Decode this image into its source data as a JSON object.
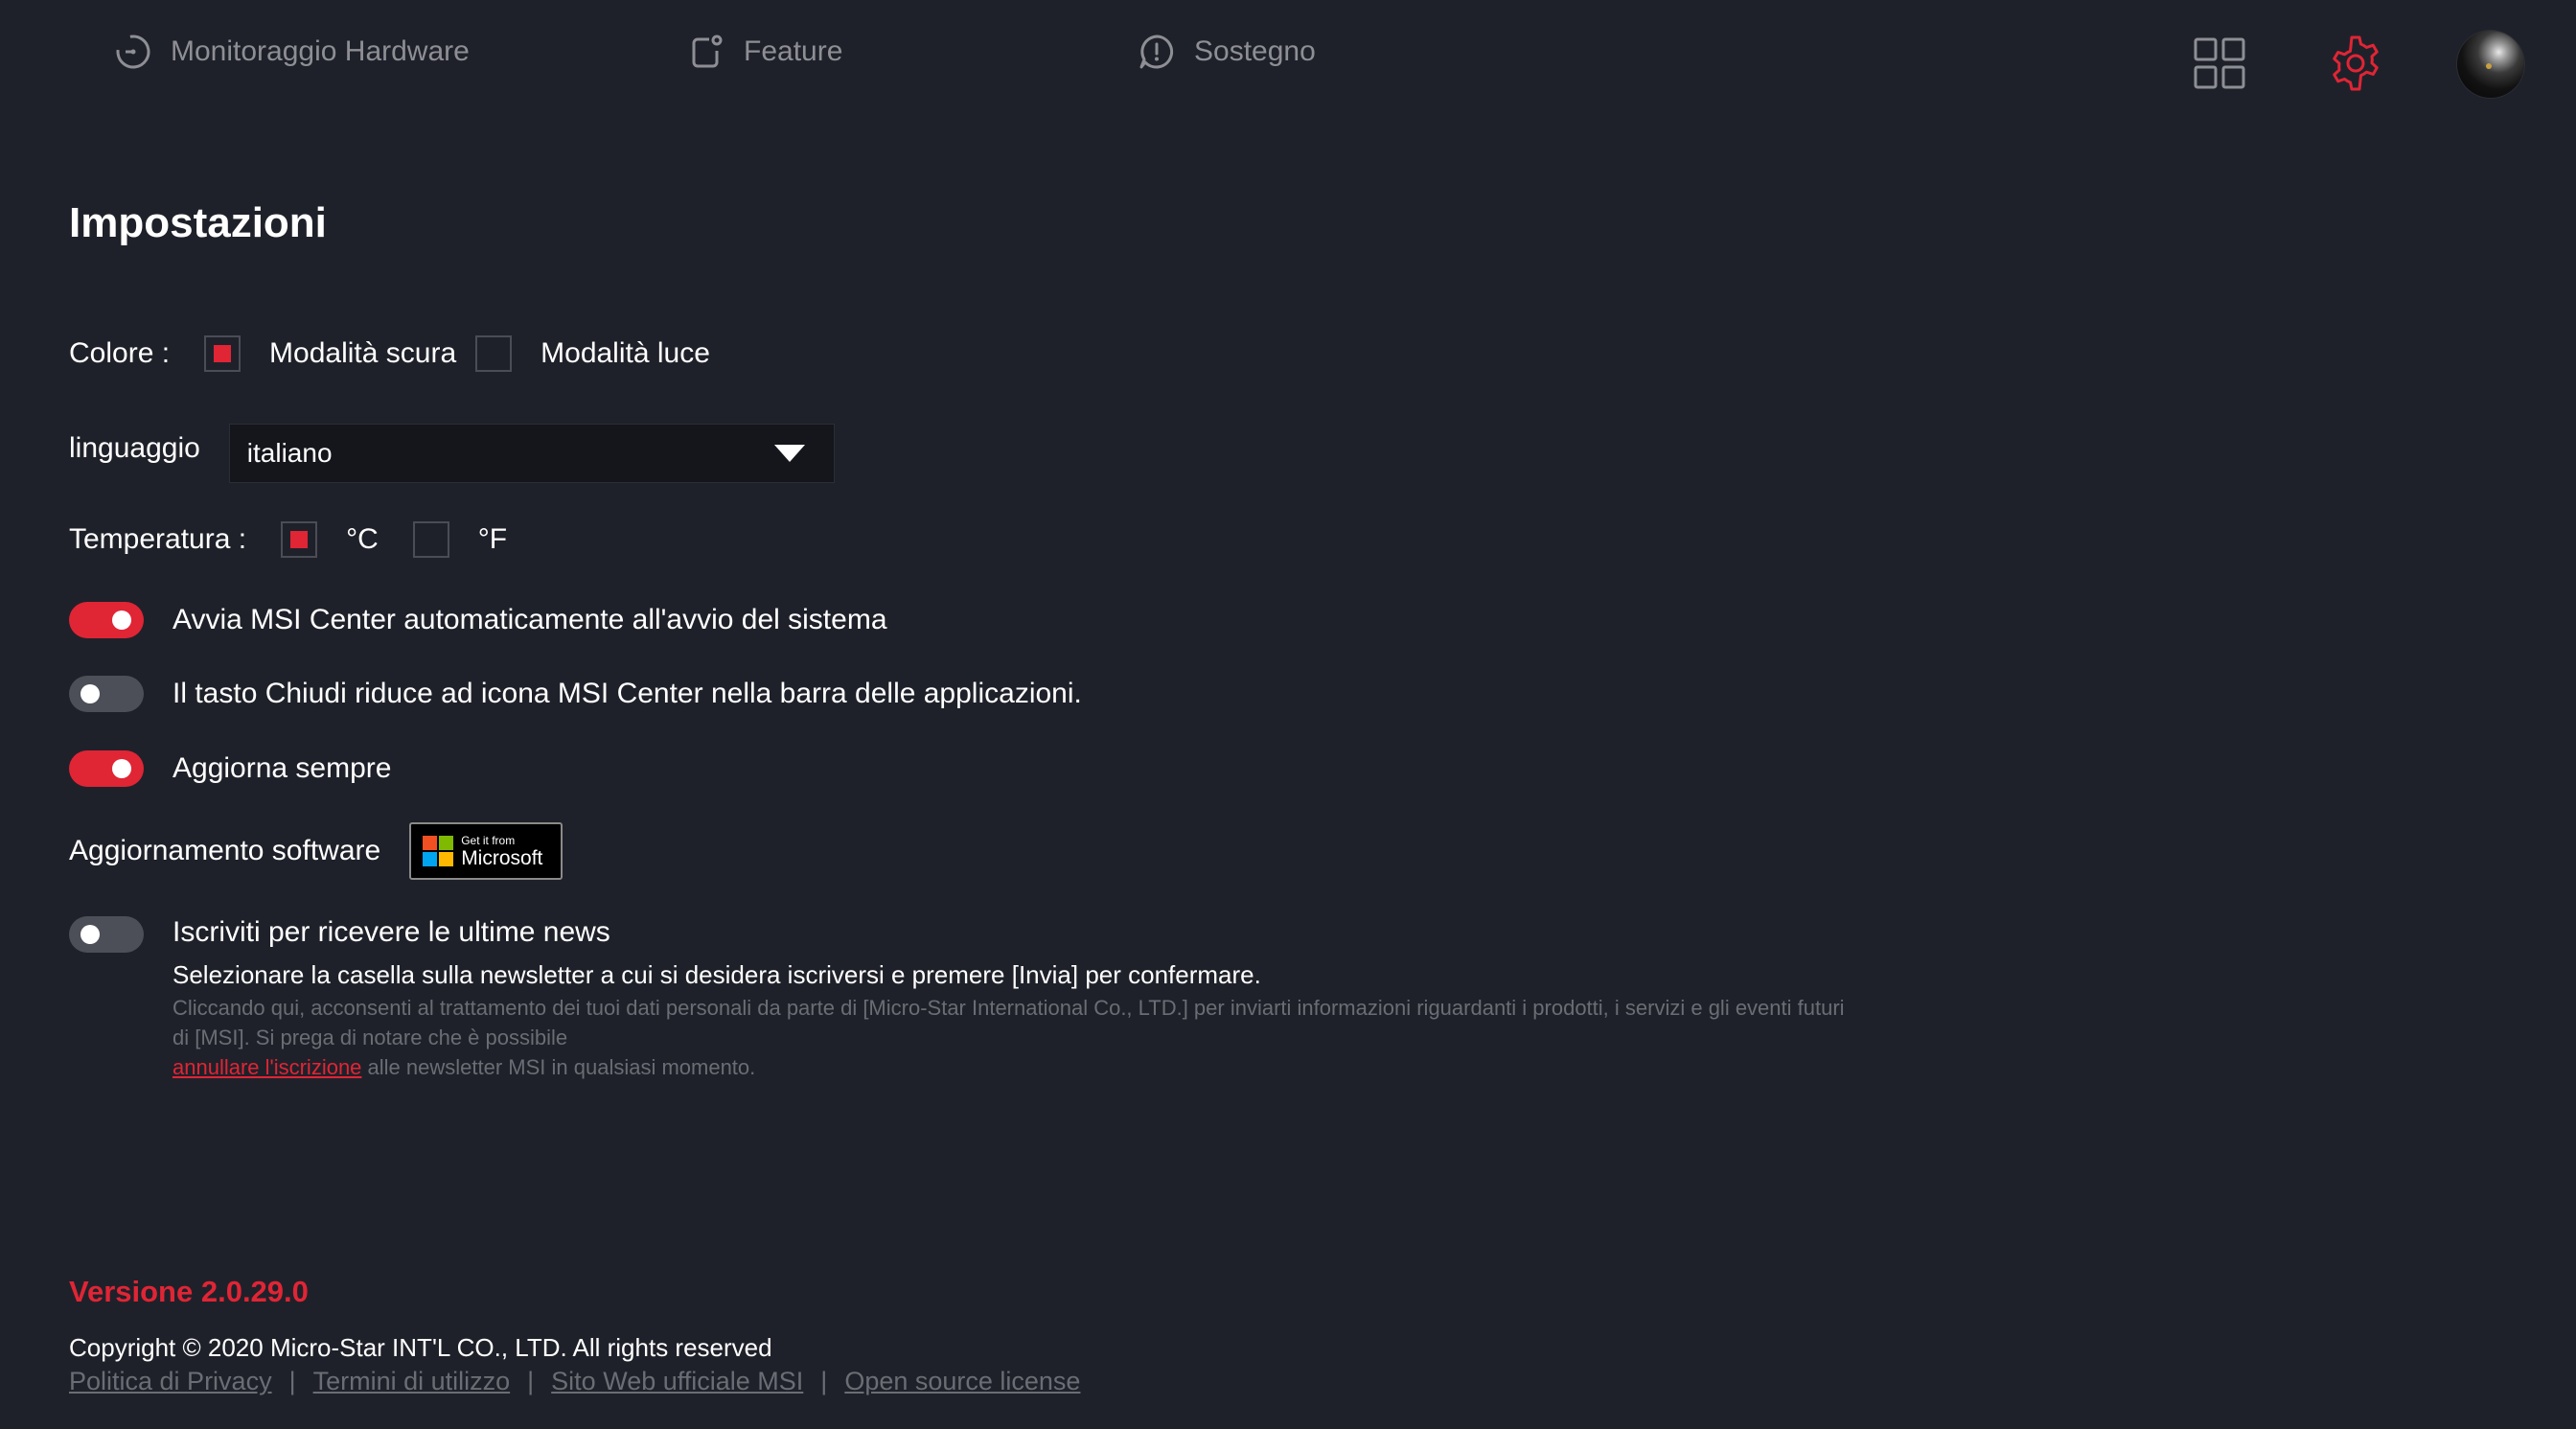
{
  "nav": {
    "items": [
      {
        "label": "Monitoraggio Hardware",
        "icon": "gauge-icon"
      },
      {
        "label": "Feature",
        "icon": "feature-icon"
      },
      {
        "label": "Sostegno",
        "icon": "support-icon"
      }
    ],
    "icons": [
      "apps-grid-icon",
      "settings-gear-icon",
      "user-avatar"
    ]
  },
  "colors": {
    "accent": "#e02535",
    "background": "#1f212a",
    "nav_text": "#8e8f95",
    "muted_text": "#6b6d74",
    "toggle_off": "#4c4f58"
  },
  "page": {
    "title": "Impostazioni"
  },
  "settings": {
    "color": {
      "label": "Colore :",
      "options": [
        {
          "label": "Modalità scura",
          "checked": true
        },
        {
          "label": "Modalità luce",
          "checked": false
        }
      ]
    },
    "language": {
      "label": "linguaggio",
      "value": "italiano"
    },
    "temperature": {
      "label": "Temperatura :",
      "options": [
        {
          "label": "°C",
          "checked": true
        },
        {
          "label": "°F",
          "checked": false
        }
      ]
    },
    "toggles": [
      {
        "label": "Avvia MSI Center automaticamente all'avvio del sistema",
        "on": true
      },
      {
        "label": "Il tasto Chiudi riduce ad icona MSI Center nella barra delle applicazioni.",
        "on": false
      },
      {
        "label": "Aggiorna sempre",
        "on": true
      }
    ],
    "software_update": {
      "label": "Aggiornamento software",
      "badge_small": "Get it from",
      "badge_big": "Microsoft"
    },
    "newsletter": {
      "label": "Iscriviti per ricevere le ultime news",
      "on": false,
      "subtitle": "Selezionare la casella sulla newsletter a cui si desidera iscriversi e premere [Invia] per confermare.",
      "fine_print": "Cliccando qui, acconsenti al trattamento dei tuoi dati personali da parte di [Micro-Star International Co., LTD.] per inviarti informazioni riguardanti i prodotti, i servizi e gli eventi futuri di [MSI]. Si prega di notare che è possibile",
      "unsubscribe_link": " annullare l'iscrizione",
      "fine_print_end": " alle newsletter MSI in qualsiasi momento."
    }
  },
  "footer": {
    "version": "Versione 2.0.29.0",
    "copyright": "Copyright © 2020 Micro-Star INT'L CO., LTD. All rights reserved",
    "links": [
      "Politica di Privacy",
      "Termini di utilizzo",
      "Sito Web ufficiale MSI",
      "Open source license"
    ],
    "separator": "|"
  }
}
